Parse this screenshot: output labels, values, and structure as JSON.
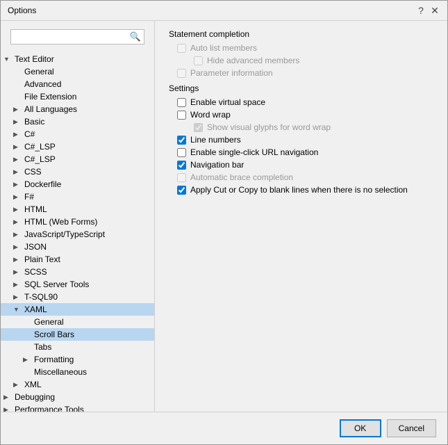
{
  "dialog": {
    "title": "Options",
    "help_label": "?",
    "close_label": "✕"
  },
  "search": {
    "placeholder": "",
    "icon": "🔍"
  },
  "tree": {
    "items": [
      {
        "id": "text-editor",
        "label": "Text Editor",
        "indent": 0,
        "arrow": "▼",
        "selected": false
      },
      {
        "id": "general",
        "label": "General",
        "indent": 1,
        "arrow": "",
        "selected": false
      },
      {
        "id": "advanced",
        "label": "Advanced",
        "indent": 1,
        "arrow": "",
        "selected": false
      },
      {
        "id": "file-extension",
        "label": "File Extension",
        "indent": 1,
        "arrow": "",
        "selected": false
      },
      {
        "id": "all-languages",
        "label": "All Languages",
        "indent": 1,
        "arrow": "▶",
        "selected": false
      },
      {
        "id": "basic",
        "label": "Basic",
        "indent": 1,
        "arrow": "▶",
        "selected": false
      },
      {
        "id": "csharp",
        "label": "C#",
        "indent": 1,
        "arrow": "▶",
        "selected": false
      },
      {
        "id": "csharp-lsp",
        "label": "C#_LSP",
        "indent": 1,
        "arrow": "▶",
        "selected": false
      },
      {
        "id": "csharp-lsp2",
        "label": "C#_LSP",
        "indent": 1,
        "arrow": "▶",
        "selected": false
      },
      {
        "id": "css",
        "label": "CSS",
        "indent": 1,
        "arrow": "▶",
        "selected": false
      },
      {
        "id": "dockerfile",
        "label": "Dockerfile",
        "indent": 1,
        "arrow": "▶",
        "selected": false
      },
      {
        "id": "fsharp",
        "label": "F#",
        "indent": 1,
        "arrow": "▶",
        "selected": false
      },
      {
        "id": "html",
        "label": "HTML",
        "indent": 1,
        "arrow": "▶",
        "selected": false
      },
      {
        "id": "html-webforms",
        "label": "HTML (Web Forms)",
        "indent": 1,
        "arrow": "▶",
        "selected": false
      },
      {
        "id": "javascript-typescript",
        "label": "JavaScript/TypeScript",
        "indent": 1,
        "arrow": "▶",
        "selected": false
      },
      {
        "id": "json",
        "label": "JSON",
        "indent": 1,
        "arrow": "▶",
        "selected": false
      },
      {
        "id": "plain-text",
        "label": "Plain Text",
        "indent": 1,
        "arrow": "▶",
        "selected": false
      },
      {
        "id": "scss",
        "label": "SCSS",
        "indent": 1,
        "arrow": "▶",
        "selected": false
      },
      {
        "id": "sql-server-tools",
        "label": "SQL Server Tools",
        "indent": 1,
        "arrow": "▶",
        "selected": false
      },
      {
        "id": "tsql90",
        "label": "T-SQL90",
        "indent": 1,
        "arrow": "▶",
        "selected": false
      },
      {
        "id": "xaml",
        "label": "XAML",
        "indent": 1,
        "arrow": "▼",
        "selected": true
      },
      {
        "id": "xaml-general",
        "label": "General",
        "indent": 2,
        "arrow": "",
        "selected": false
      },
      {
        "id": "xaml-scrollbars",
        "label": "Scroll Bars",
        "indent": 2,
        "arrow": "",
        "selected": true
      },
      {
        "id": "xaml-tabs",
        "label": "Tabs",
        "indent": 2,
        "arrow": "",
        "selected": false
      },
      {
        "id": "xaml-formatting",
        "label": "Formatting",
        "indent": 2,
        "arrow": "▶",
        "selected": false
      },
      {
        "id": "xaml-misc",
        "label": "Miscellaneous",
        "indent": 2,
        "arrow": "",
        "selected": false
      },
      {
        "id": "xml",
        "label": "XML",
        "indent": 1,
        "arrow": "▶",
        "selected": false
      },
      {
        "id": "debugging",
        "label": "Debugging",
        "indent": 0,
        "arrow": "▶",
        "selected": false
      },
      {
        "id": "performance-tools",
        "label": "Performance Tools",
        "indent": 0,
        "arrow": "▶",
        "selected": false
      }
    ]
  },
  "right_panel": {
    "statement_completion": {
      "title": "Statement completion",
      "options": [
        {
          "id": "auto-list",
          "label": "Auto list members",
          "checked": false,
          "disabled": true
        },
        {
          "id": "hide-advanced",
          "label": "Hide advanced members",
          "checked": false,
          "disabled": true,
          "indent": true
        },
        {
          "id": "parameter-info",
          "label": "Parameter information",
          "checked": false,
          "disabled": true
        }
      ]
    },
    "settings": {
      "title": "Settings",
      "options": [
        {
          "id": "virtual-space",
          "label": "Enable virtual space",
          "checked": false,
          "disabled": false
        },
        {
          "id": "word-wrap",
          "label": "Word wrap",
          "checked": false,
          "disabled": false
        },
        {
          "id": "show-glyphs",
          "label": "Show visual glyphs for word wrap",
          "checked": true,
          "disabled": true,
          "indent": true
        },
        {
          "id": "line-numbers",
          "label": "Line numbers",
          "checked": true,
          "disabled": false
        },
        {
          "id": "single-click-url",
          "label": "Enable single-click URL navigation",
          "checked": false,
          "disabled": false
        },
        {
          "id": "nav-bar",
          "label": "Navigation bar",
          "checked": true,
          "disabled": false
        },
        {
          "id": "auto-brace",
          "label": "Automatic brace completion",
          "checked": false,
          "disabled": true
        },
        {
          "id": "apply-cut-copy",
          "label": "Apply Cut or Copy to blank lines when there is no selection",
          "checked": true,
          "disabled": false
        }
      ]
    }
  },
  "buttons": {
    "ok": "OK",
    "cancel": "Cancel"
  }
}
